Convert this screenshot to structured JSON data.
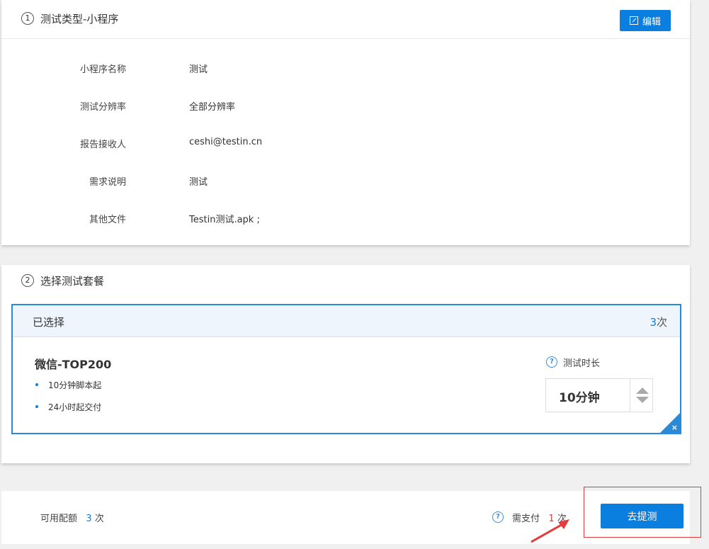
{
  "step1": {
    "number": "1",
    "title": "测试类型-小程序",
    "edit_label": "编辑",
    "rows": [
      {
        "label": "小程序名称",
        "value": "测试"
      },
      {
        "label": "测试分辨率",
        "value": "全部分辨率"
      },
      {
        "label": "报告接收人",
        "value": "ceshi@testin.cn"
      },
      {
        "label": "需求说明",
        "value": "测试"
      },
      {
        "label": "其他文件",
        "value": "Testin测试.apk ;"
      }
    ]
  },
  "step2": {
    "number": "2",
    "title": "选择测试套餐",
    "selected_label": "已选择",
    "count_num": "3",
    "count_unit": "次",
    "package": {
      "name": "微信-TOP200",
      "features": [
        "10分钟脚本起",
        "24小时起交付"
      ]
    },
    "duration_label": "测试时长",
    "duration_value": "10分钟",
    "help_icon": "?",
    "close_icon": "×"
  },
  "footer": {
    "quota_label": "可用配额",
    "quota_num": "3",
    "quota_unit": "次",
    "pay_label": "需支付",
    "pay_num": "1",
    "pay_unit": "次",
    "submit_label": "去提测"
  },
  "colors": {
    "accent": "#0a7fe0",
    "highlight": "#e53b3b"
  }
}
